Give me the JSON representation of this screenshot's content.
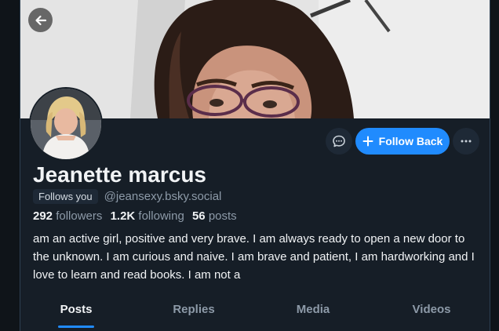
{
  "profile": {
    "display_name": "Jeanette marcus",
    "follows_you_label": "Follows you",
    "handle": "@jeansexy.bsky.social",
    "followers_count": "292",
    "followers_label": "followers",
    "following_count": "1.2K",
    "following_label": "following",
    "posts_count": "56",
    "posts_label": "posts",
    "bio": "am an active girl, positive and very brave. I am always ready to open a new door to the unknown. I am curious and naive. I am brave and patient, I am hardworking and I love to learn and read books. I am not a"
  },
  "actions": {
    "follow_back_label": "Follow Back"
  },
  "tabs": [
    {
      "label": "Posts",
      "active": true
    },
    {
      "label": "Replies",
      "active": false
    },
    {
      "label": "Media",
      "active": false
    },
    {
      "label": "Videos",
      "active": false
    }
  ],
  "icons": {
    "back": "arrow-left-icon",
    "message": "chat-bubble-icon",
    "follow": "plus-icon",
    "more": "ellipsis-icon"
  },
  "colors": {
    "accent": "#208bfe",
    "background": "#161e27",
    "muted_text": "#8d9aa8"
  }
}
